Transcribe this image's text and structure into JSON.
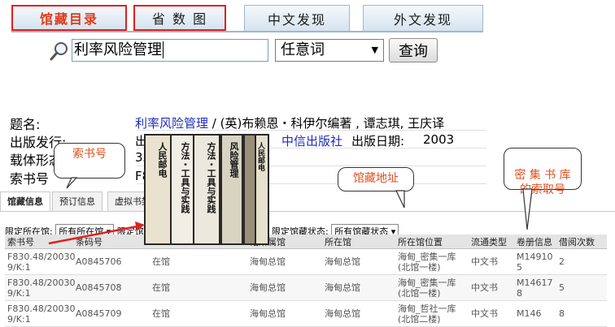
{
  "tabs": [
    {
      "label": "馆藏目录",
      "active": true
    },
    {
      "label": "省 数 图",
      "active": false
    },
    {
      "label": "中文发现",
      "active": false
    },
    {
      "label": "外文发现",
      "active": false
    }
  ],
  "search": {
    "value": "利率风险管理",
    "field": "任意词",
    "button": "查询"
  },
  "record": {
    "labels": [
      "题名:",
      "出版发行:",
      "载体形态:",
      "索书号"
    ],
    "title": "利率风险管理",
    "sep": "/",
    "author": "(英)布赖恩・科伊尔编著 , 谭志琪, 王庆译",
    "publisher_prefix": "出版",
    "publisher": "中信出版社",
    "date_label": "出版日期:",
    "date": "2003",
    "form_value": "33",
    "callno_value": "F8"
  },
  "callouts": {
    "callno": "索书号",
    "location": "馆藏地址",
    "dense": "密 集 书 库\n的索取号"
  },
  "photo_books": [
    "方法・工具与实践",
    "方法・工具与实践",
    "风险管理",
    "人民邮电",
    "人民邮电"
  ],
  "subtabs": [
    "馆藏信息",
    "预订信息",
    "虚拟书架"
  ],
  "filters": {
    "location_label": "限定所在馆:",
    "location_value": "所有所在馆",
    "other_label": "限定馆",
    "status_label": "限定馆藏状态:",
    "status_value": "所有馆藏状态"
  },
  "table": {
    "headers": [
      "索书号",
      "条码号",
      "",
      "",
      "馆所属馆",
      "所在馆",
      "所在馆位置",
      "流通类型",
      "卷册信息",
      "借阅次数"
    ],
    "rows": [
      [
        "F830.48/20030 9/K:1",
        "A0845706",
        "在馆",
        "",
        "海甸总馆",
        "海甸总馆",
        "海甸_密集一库 (北馆一楼)",
        "中文书",
        "M149105",
        "2"
      ],
      [
        "F830.48/20030 9/K:1",
        "A0845708",
        "在馆",
        "",
        "海甸总馆",
        "海甸总馆",
        "海甸_密集一库 (北馆一楼)",
        "中文书",
        "M146178",
        "5"
      ],
      [
        "F830.48/20030 9/K:1",
        "A0845709",
        "在馆",
        "",
        "海甸总馆",
        "海甸总馆",
        "海甸_哲社一库 (北馆二楼)",
        "中文书",
        "M146",
        "8"
      ]
    ]
  },
  "colors": {
    "highlight_box": "#e02020",
    "callout_text": "#e05020",
    "link": "#1d2db8"
  }
}
